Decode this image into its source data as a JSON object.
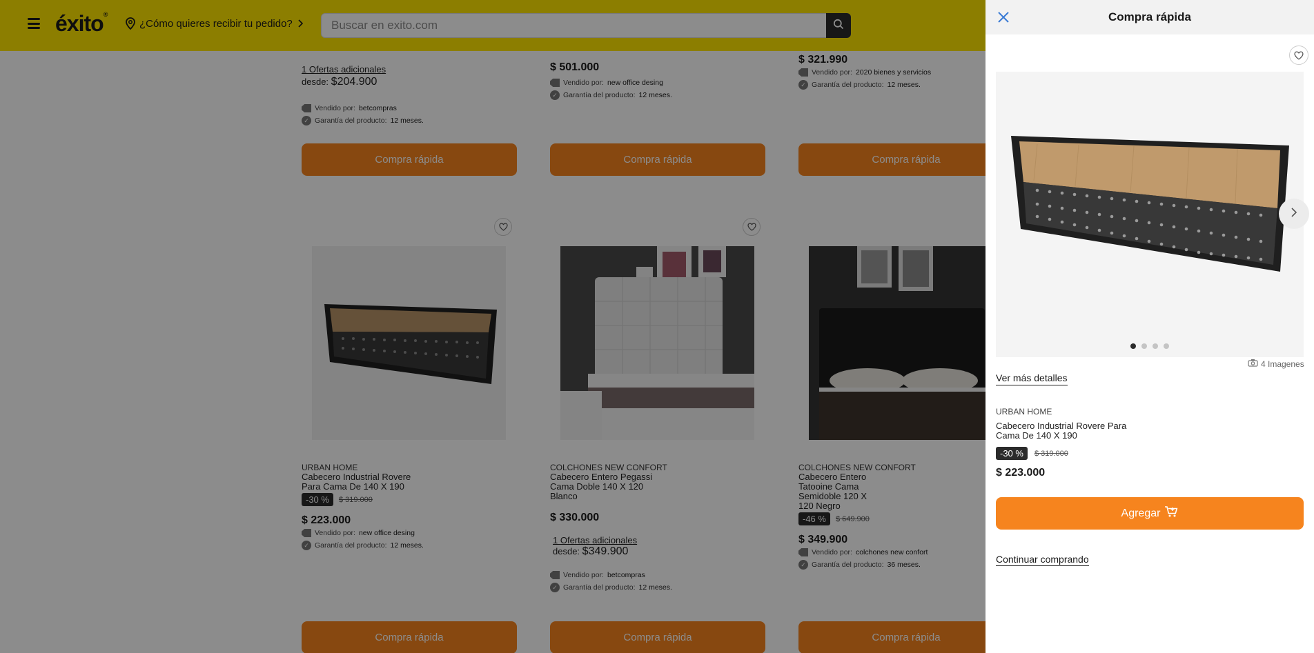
{
  "header": {
    "logo": "éxito",
    "logo_mark": "®",
    "delivery_text": "¿Cómo quieres recibir tu pedido?",
    "search_placeholder": "Buscar en exito.com"
  },
  "products_top": [
    {
      "offers": "1 Ofertas adicionales",
      "desde_label": "desde:",
      "desde_price": "$204.900",
      "seller_label": "Vendido por:",
      "seller": "betcompras",
      "warranty_label": "Garantía del producto:",
      "warranty": "12 meses.",
      "button": "Compra rápida"
    },
    {
      "price": "$ 501.000",
      "seller_label": "Vendido por:",
      "seller": "new office desing",
      "warranty_label": "Garantía del producto:",
      "warranty": "12 meses.",
      "button": "Compra rápida"
    },
    {
      "price": "$ 321.990",
      "seller_label": "Vendido por:",
      "seller": "2020 bienes y servicios",
      "warranty_label": "Garantía del producto:",
      "warranty": "12 meses.",
      "button": "Compra rápida"
    }
  ],
  "products_bottom": [
    {
      "brand": "URBAN HOME",
      "name": "Cabecero Industrial Rovere Para Cama De 140 X 190",
      "discount": "-30 %",
      "old_price": "$ 319.000",
      "price": "$ 223.000",
      "seller_label": "Vendido por:",
      "seller": "new office desing",
      "warranty_label": "Garantía del producto:",
      "warranty": "12 meses.",
      "button": "Compra rápida"
    },
    {
      "brand": "COLCHONES NEW CONFORT",
      "name": "Cabecero Entero Pegassi Cama Doble 140 X 120 Blanco",
      "price": "$ 330.000",
      "offers": "1 Ofertas adicionales",
      "desde_label": "desde:",
      "desde_price": "$349.900",
      "seller_label": "Vendido por:",
      "seller": "betcompras",
      "warranty_label": "Garantía del producto:",
      "warranty": "12 meses.",
      "button": "Compra rápida"
    },
    {
      "brand": "COLCHONES NEW CONFORT",
      "name": "Cabecero Entero Tatooine Cama Semidoble 120 X 120 Negro",
      "discount": "-46 %",
      "old_price": "$ 649.900",
      "price": "$ 349.900",
      "seller_label": "Vendido por:",
      "seller": "colchones new confort",
      "warranty_label": "Garantía del producto:",
      "warranty": "36 meses.",
      "button": "Compra rápida"
    }
  ],
  "panel": {
    "title": "Compra rápida",
    "image_count": "4 Imagenes",
    "details_link": "Ver más detalles",
    "brand": "URBAN HOME",
    "name": "Cabecero Industrial Rovere Para Cama De 140 X 190",
    "discount": "-30 %",
    "old_price": "$ 319.000",
    "price": "$ 223.000",
    "add_button": "Agregar",
    "continue_link": "Continuar comprando",
    "gallery_total": 4,
    "gallery_active": 1
  },
  "colors": {
    "header_bg": "#ffe600",
    "accent_orange": "#f6841e",
    "badge_dark": "#2b2b2b"
  }
}
